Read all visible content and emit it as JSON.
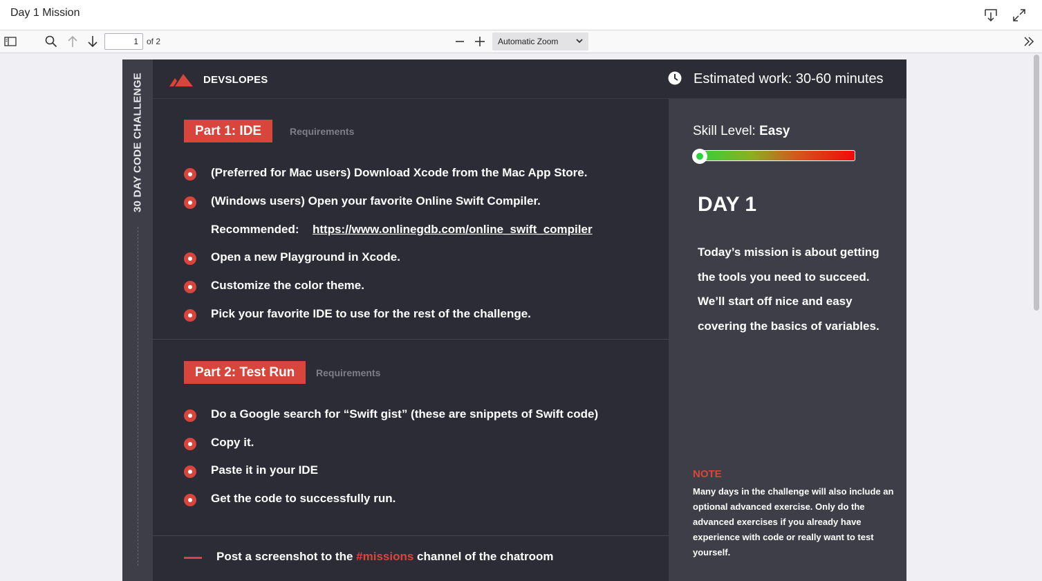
{
  "window": {
    "title": "Day 1 Mission"
  },
  "toolbar": {
    "page_number": "1",
    "page_count_label": "of 2",
    "zoom_label": "Automatic Zoom"
  },
  "document": {
    "side_label": "30 DAY CODE CHALLENGE",
    "brand": "DEVSLOPES",
    "estimated_work": "Estimated work: 30-60 minutes",
    "part1": {
      "title": "Part 1: IDE",
      "requirements_label": "Requirements",
      "items": [
        "(Preferred for Mac users) Download Xcode from the Mac App Store.",
        "(Windows users) Open your favorite Online Swift Compiler.",
        "Open a new Playground in Xcode.",
        "Customize the color theme.",
        "Pick your favorite IDE to use for the rest of the challenge."
      ],
      "recommended_label": "Recommended:",
      "recommended_link": "https://www.onlinegdb.com/online_swift_compiler"
    },
    "part2": {
      "title": "Part 2: Test Run",
      "requirements_label": "Requirements",
      "items": [
        "Do a Google search for “Swift gist” (these are snippets of Swift code)",
        "Copy it.",
        "Paste it in your IDE",
        "Get the code to successfully run."
      ]
    },
    "post": {
      "before": "Post a screenshot to the ",
      "channel": "#missions",
      "after": " channel of the chatroom"
    },
    "right": {
      "skill_label": "Skill Level: ",
      "skill_value": "Easy",
      "skill_level_fraction": 0.0,
      "day": "DAY 1",
      "mission": "Today’s mission is about getting the tools you need to succeed. We’ll start off nice and easy covering the basics of variables.",
      "note_label": "NOTE",
      "note": "Many days in the challenge will also include an optional advanced exercise. Only do the advanced exercises if you already have experience with code or really want to test yourself."
    }
  },
  "colors": {
    "accent": "#d8453c",
    "page_bg": "#2c2c36",
    "panel_bg": "#3e3e48"
  }
}
